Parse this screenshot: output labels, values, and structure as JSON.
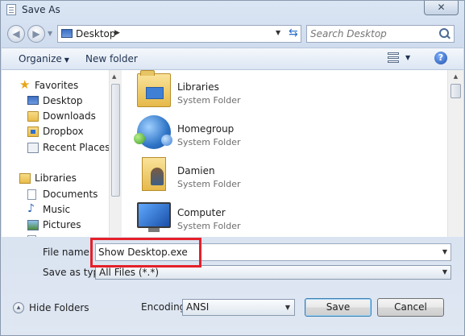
{
  "window": {
    "title": "Save As",
    "close_label": "✕"
  },
  "address": {
    "path": "Desktop",
    "search_placeholder": "Search Desktop"
  },
  "toolbar": {
    "organize_label": "Organize",
    "new_folder_label": "New folder",
    "help_label": "?"
  },
  "navpane": {
    "favorites_label": "Favorites",
    "favorites": [
      {
        "label": "Desktop"
      },
      {
        "label": "Downloads"
      },
      {
        "label": "Dropbox"
      },
      {
        "label": "Recent Places"
      }
    ],
    "libraries_label": "Libraries",
    "libraries": [
      {
        "label": "Documents"
      },
      {
        "label": "Music"
      },
      {
        "label": "Pictures"
      }
    ]
  },
  "files": [
    {
      "name": "Libraries",
      "type": "System Folder",
      "icon": "libraries-icon"
    },
    {
      "name": "Homegroup",
      "type": "System Folder",
      "icon": "homegroup-icon"
    },
    {
      "name": "Damien",
      "type": "System Folder",
      "icon": "user-folder-icon"
    },
    {
      "name": "Computer",
      "type": "System Folder",
      "icon": "computer-icon"
    }
  ],
  "form": {
    "file_name_label": "File name:",
    "file_name_value": "Show Desktop.exe",
    "save_as_type_label": "Save as type:",
    "save_as_type_value": "All Files  (*.*)",
    "hide_folders_label": "Hide Folders",
    "encoding_label": "Encoding:",
    "encoding_value": "ANSI",
    "save_label": "Save",
    "cancel_label": "Cancel"
  },
  "colors": {
    "highlight": "#e4202a",
    "accent": "#2a6fc9"
  }
}
